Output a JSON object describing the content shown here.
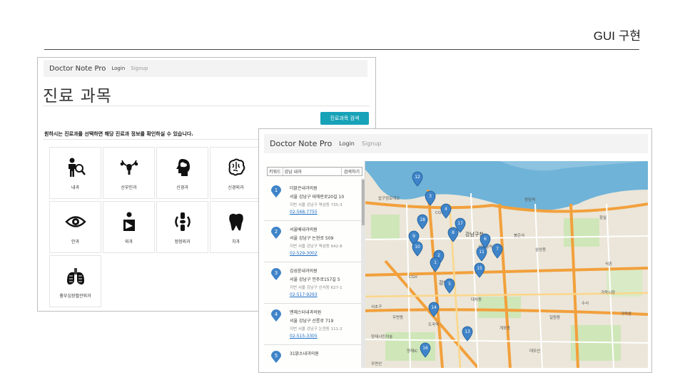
{
  "slide": {
    "title": "GUI 구현"
  },
  "window1": {
    "brand": "Doctor Note Pro",
    "nav": [
      "Login",
      "Signup"
    ],
    "heading": "진료 과목",
    "search_button": "진료과목 검색",
    "intro": "원하시는 진료과를 선택하면 해당 진료과 정보를 확인하실 수 있습니다.",
    "departments": [
      {
        "label": "내과",
        "icon": "doctor-magnifier-icon"
      },
      {
        "label": "산부인과",
        "icon": "uterus-icon"
      },
      {
        "label": "신경과",
        "icon": "head-brain-icon"
      },
      {
        "label": "신경외과",
        "icon": "brain-icon"
      },
      {
        "label": "안과",
        "icon": "eye-icon"
      },
      {
        "label": "외과",
        "icon": "injured-arm-icon"
      },
      {
        "label": "정형외과",
        "icon": "bone-joint-icon"
      },
      {
        "label": "치과",
        "icon": "tooth-icon"
      },
      {
        "label": "흉부심장혈관외과",
        "icon": "lungs-icon"
      }
    ]
  },
  "window2": {
    "brand": "Doctor Note Pro",
    "nav": [
      "Login",
      "Signup"
    ],
    "search": {
      "keyword_label": "키워드",
      "value": "강남 내과",
      "button": "검색하기"
    },
    "clinics": [
      {
        "num": "1",
        "name": "더맑은내과의원",
        "addr": "서울 강남구 테헤란로20길 10",
        "jibun": "서울 강남구 역삼동 735-3",
        "jibun_tag": "지번",
        "phone": "02-568-7755"
      },
      {
        "num": "2",
        "name": "서울베내과의원",
        "addr": "서울 강남구 논현로 509",
        "jibun": "서울 강남구 역삼동 642-8",
        "jibun_tag": "지번",
        "phone": "02-529-3002"
      },
      {
        "num": "3",
        "name": "김성윤내과의원",
        "addr": "서울 강남구 언주로157길 5",
        "jibun": "서울 강남구 신사동 627-1",
        "jibun_tag": "지번",
        "phone": "02-517-9293"
      },
      {
        "num": "4",
        "name": "맨체스터내과의원",
        "addr": "서울 강남구 선릉로 719",
        "jibun": "서울 강남구 논현동 111-2",
        "jibun_tag": "지번",
        "phone": "02-515-3305"
      },
      {
        "num": "5",
        "name": "31맑소내과의원",
        "addr": "",
        "jibun": "",
        "jibun_tag": "",
        "phone": ""
      }
    ],
    "map_labels": [
      "CGV",
      "강남구청",
      "선정릉역",
      "CGV",
      "강남구",
      "청담역",
      "압구정로데오",
      "봉은사",
      "대치동",
      "도곡역",
      "양재IC",
      "양재시민의숲",
      "우면산",
      "대모산",
      "삼성동",
      "잠실",
      "석촌",
      "가락시장",
      "수서",
      "일원동",
      "가락동",
      "개포동",
      "우면동",
      "서초구"
    ],
    "map_pins": [
      "12",
      "3",
      "4",
      "9",
      "8",
      "6",
      "10",
      "2",
      "1",
      "11",
      "7",
      "13",
      "5",
      "15",
      "14",
      "16",
      "17",
      "18"
    ]
  },
  "colors": {
    "accent": "#17a2b8",
    "pin": "#3f84c8",
    "river": "#6fb3d8",
    "road": "#f2a03c"
  }
}
